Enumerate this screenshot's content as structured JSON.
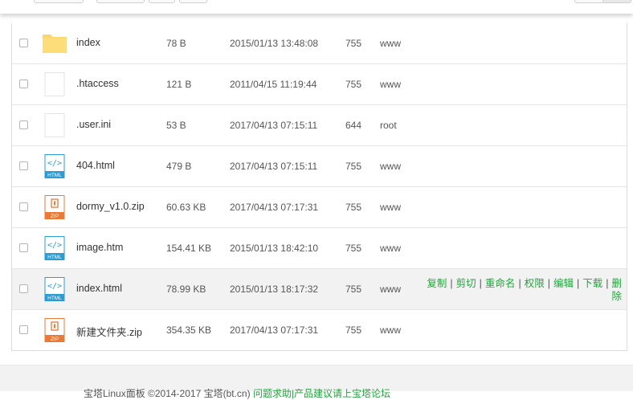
{
  "files": [
    {
      "name": "index",
      "size": "78 B",
      "time": "2015/01/13 13:48:08",
      "perm": "755",
      "owner": "www",
      "type": "folder"
    },
    {
      "name": ".htaccess",
      "size": "121 B",
      "time": "2011/04/15 11:19:44",
      "perm": "755",
      "owner": "www",
      "type": "file"
    },
    {
      "name": ".user.ini",
      "size": "53 B",
      "time": "2017/04/13 07:15:11",
      "perm": "644",
      "owner": "root",
      "type": "file"
    },
    {
      "name": "404.html",
      "size": "479 B",
      "time": "2017/04/13 07:15:11",
      "perm": "755",
      "owner": "www",
      "type": "html"
    },
    {
      "name": "dormy_v1.0.zip",
      "size": "60.63 KB",
      "time": "2017/04/13 07:17:31",
      "perm": "755",
      "owner": "www",
      "type": "zip"
    },
    {
      "name": "image.htm",
      "size": "154.41 KB",
      "time": "2015/01/13 18:42:10",
      "perm": "755",
      "owner": "www",
      "type": "html"
    },
    {
      "name": "index.html",
      "size": "78.99 KB",
      "time": "2015/01/13 18:17:32",
      "perm": "755",
      "owner": "www",
      "type": "html"
    },
    {
      "name": "新建文件夹.zip",
      "size": "354.35 KB",
      "time": "2017/04/13 07:17:31",
      "perm": "755",
      "owner": "www",
      "type": "zip"
    }
  ],
  "icon_labels": {
    "html": "HTML",
    "zip": "ZIP"
  },
  "row_actions": {
    "copy": "复制",
    "cut": "剪切",
    "rename": "重命名",
    "permission": "权限",
    "edit": "编辑",
    "download": "下载",
    "delete": "删除"
  },
  "footer": {
    "text": "宝塔Linux面板 ©2014-2017 宝塔(bt.cn)",
    "link": "问题求助|产品建议请上宝塔论坛"
  },
  "colors": {
    "accent": "#20a53a",
    "folder": "#fcd66a",
    "html_icon": "#2b9bd4",
    "zip_icon": "#ea7a35"
  }
}
